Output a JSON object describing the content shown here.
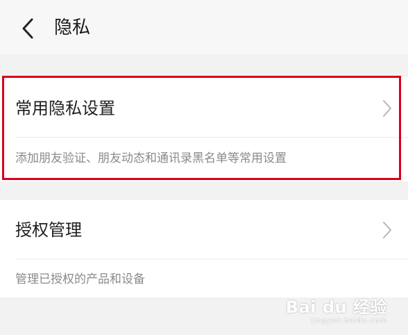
{
  "header": {
    "back_icon": "chevron-left-icon",
    "title": "隐私"
  },
  "sections": [
    {
      "title": "常用隐私设置",
      "subtitle": "添加朋友验证、朋友动态和通讯录黑名单等常用设置",
      "chevron_icon": "chevron-right-icon"
    },
    {
      "title": "授权管理",
      "subtitle": "管理已授权的产品和设备",
      "chevron_icon": "chevron-right-icon"
    }
  ],
  "highlight": {
    "color": "#d9001b"
  },
  "watermark": {
    "logo": "Bai du 经验",
    "url": "jingyan.baidu.com"
  }
}
